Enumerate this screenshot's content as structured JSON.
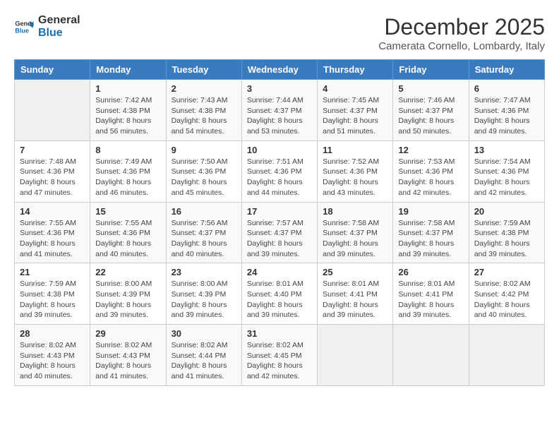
{
  "header": {
    "logo_line1": "General",
    "logo_line2": "Blue",
    "title": "December 2025",
    "subtitle": "Camerata Cornello, Lombardy, Italy"
  },
  "days_of_week": [
    "Sunday",
    "Monday",
    "Tuesday",
    "Wednesday",
    "Thursday",
    "Friday",
    "Saturday"
  ],
  "weeks": [
    [
      {
        "day": "",
        "sunrise": "",
        "sunset": "",
        "daylight": ""
      },
      {
        "day": "1",
        "sunrise": "Sunrise: 7:42 AM",
        "sunset": "Sunset: 4:38 PM",
        "daylight": "Daylight: 8 hours and 56 minutes."
      },
      {
        "day": "2",
        "sunrise": "Sunrise: 7:43 AM",
        "sunset": "Sunset: 4:38 PM",
        "daylight": "Daylight: 8 hours and 54 minutes."
      },
      {
        "day": "3",
        "sunrise": "Sunrise: 7:44 AM",
        "sunset": "Sunset: 4:37 PM",
        "daylight": "Daylight: 8 hours and 53 minutes."
      },
      {
        "day": "4",
        "sunrise": "Sunrise: 7:45 AM",
        "sunset": "Sunset: 4:37 PM",
        "daylight": "Daylight: 8 hours and 51 minutes."
      },
      {
        "day": "5",
        "sunrise": "Sunrise: 7:46 AM",
        "sunset": "Sunset: 4:37 PM",
        "daylight": "Daylight: 8 hours and 50 minutes."
      },
      {
        "day": "6",
        "sunrise": "Sunrise: 7:47 AM",
        "sunset": "Sunset: 4:36 PM",
        "daylight": "Daylight: 8 hours and 49 minutes."
      }
    ],
    [
      {
        "day": "7",
        "sunrise": "Sunrise: 7:48 AM",
        "sunset": "Sunset: 4:36 PM",
        "daylight": "Daylight: 8 hours and 47 minutes."
      },
      {
        "day": "8",
        "sunrise": "Sunrise: 7:49 AM",
        "sunset": "Sunset: 4:36 PM",
        "daylight": "Daylight: 8 hours and 46 minutes."
      },
      {
        "day": "9",
        "sunrise": "Sunrise: 7:50 AM",
        "sunset": "Sunset: 4:36 PM",
        "daylight": "Daylight: 8 hours and 45 minutes."
      },
      {
        "day": "10",
        "sunrise": "Sunrise: 7:51 AM",
        "sunset": "Sunset: 4:36 PM",
        "daylight": "Daylight: 8 hours and 44 minutes."
      },
      {
        "day": "11",
        "sunrise": "Sunrise: 7:52 AM",
        "sunset": "Sunset: 4:36 PM",
        "daylight": "Daylight: 8 hours and 43 minutes."
      },
      {
        "day": "12",
        "sunrise": "Sunrise: 7:53 AM",
        "sunset": "Sunset: 4:36 PM",
        "daylight": "Daylight: 8 hours and 42 minutes."
      },
      {
        "day": "13",
        "sunrise": "Sunrise: 7:54 AM",
        "sunset": "Sunset: 4:36 PM",
        "daylight": "Daylight: 8 hours and 42 minutes."
      }
    ],
    [
      {
        "day": "14",
        "sunrise": "Sunrise: 7:55 AM",
        "sunset": "Sunset: 4:36 PM",
        "daylight": "Daylight: 8 hours and 41 minutes."
      },
      {
        "day": "15",
        "sunrise": "Sunrise: 7:55 AM",
        "sunset": "Sunset: 4:36 PM",
        "daylight": "Daylight: 8 hours and 40 minutes."
      },
      {
        "day": "16",
        "sunrise": "Sunrise: 7:56 AM",
        "sunset": "Sunset: 4:37 PM",
        "daylight": "Daylight: 8 hours and 40 minutes."
      },
      {
        "day": "17",
        "sunrise": "Sunrise: 7:57 AM",
        "sunset": "Sunset: 4:37 PM",
        "daylight": "Daylight: 8 hours and 39 minutes."
      },
      {
        "day": "18",
        "sunrise": "Sunrise: 7:58 AM",
        "sunset": "Sunset: 4:37 PM",
        "daylight": "Daylight: 8 hours and 39 minutes."
      },
      {
        "day": "19",
        "sunrise": "Sunrise: 7:58 AM",
        "sunset": "Sunset: 4:37 PM",
        "daylight": "Daylight: 8 hours and 39 minutes."
      },
      {
        "day": "20",
        "sunrise": "Sunrise: 7:59 AM",
        "sunset": "Sunset: 4:38 PM",
        "daylight": "Daylight: 8 hours and 39 minutes."
      }
    ],
    [
      {
        "day": "21",
        "sunrise": "Sunrise: 7:59 AM",
        "sunset": "Sunset: 4:38 PM",
        "daylight": "Daylight: 8 hours and 39 minutes."
      },
      {
        "day": "22",
        "sunrise": "Sunrise: 8:00 AM",
        "sunset": "Sunset: 4:39 PM",
        "daylight": "Daylight: 8 hours and 39 minutes."
      },
      {
        "day": "23",
        "sunrise": "Sunrise: 8:00 AM",
        "sunset": "Sunset: 4:39 PM",
        "daylight": "Daylight: 8 hours and 39 minutes."
      },
      {
        "day": "24",
        "sunrise": "Sunrise: 8:01 AM",
        "sunset": "Sunset: 4:40 PM",
        "daylight": "Daylight: 8 hours and 39 minutes."
      },
      {
        "day": "25",
        "sunrise": "Sunrise: 8:01 AM",
        "sunset": "Sunset: 4:41 PM",
        "daylight": "Daylight: 8 hours and 39 minutes."
      },
      {
        "day": "26",
        "sunrise": "Sunrise: 8:01 AM",
        "sunset": "Sunset: 4:41 PM",
        "daylight": "Daylight: 8 hours and 39 minutes."
      },
      {
        "day": "27",
        "sunrise": "Sunrise: 8:02 AM",
        "sunset": "Sunset: 4:42 PM",
        "daylight": "Daylight: 8 hours and 40 minutes."
      }
    ],
    [
      {
        "day": "28",
        "sunrise": "Sunrise: 8:02 AM",
        "sunset": "Sunset: 4:43 PM",
        "daylight": "Daylight: 8 hours and 40 minutes."
      },
      {
        "day": "29",
        "sunrise": "Sunrise: 8:02 AM",
        "sunset": "Sunset: 4:43 PM",
        "daylight": "Daylight: 8 hours and 41 minutes."
      },
      {
        "day": "30",
        "sunrise": "Sunrise: 8:02 AM",
        "sunset": "Sunset: 4:44 PM",
        "daylight": "Daylight: 8 hours and 41 minutes."
      },
      {
        "day": "31",
        "sunrise": "Sunrise: 8:02 AM",
        "sunset": "Sunset: 4:45 PM",
        "daylight": "Daylight: 8 hours and 42 minutes."
      },
      {
        "day": "",
        "sunrise": "",
        "sunset": "",
        "daylight": ""
      },
      {
        "day": "",
        "sunrise": "",
        "sunset": "",
        "daylight": ""
      },
      {
        "day": "",
        "sunrise": "",
        "sunset": "",
        "daylight": ""
      }
    ]
  ]
}
